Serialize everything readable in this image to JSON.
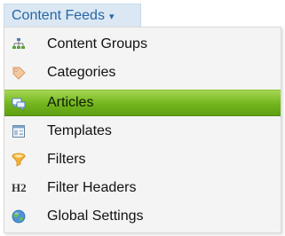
{
  "menu": {
    "title": "Content Feeds",
    "caret": "▾",
    "items": [
      {
        "label": "Content Groups",
        "icon": "org-chart-icon",
        "active": false
      },
      {
        "label": "Categories",
        "icon": "tag-icon",
        "active": false
      },
      {
        "label": "Articles",
        "icon": "speech-bubbles-icon",
        "active": true
      },
      {
        "label": "Templates",
        "icon": "layout-template-icon",
        "active": false
      },
      {
        "label": "Filters",
        "icon": "filter-funnel-icon",
        "active": false
      },
      {
        "label": "Filter Headers",
        "icon": "h2-heading-icon",
        "icon_text": "H2",
        "active": false
      },
      {
        "label": "Global Settings",
        "icon": "globe-icon",
        "active": false
      }
    ]
  },
  "colors": {
    "trigger_text": "#2866a6",
    "trigger_bg": "#dbe8f3",
    "active_green": "#72b51d",
    "menu_bg": "#f4f4f4"
  }
}
